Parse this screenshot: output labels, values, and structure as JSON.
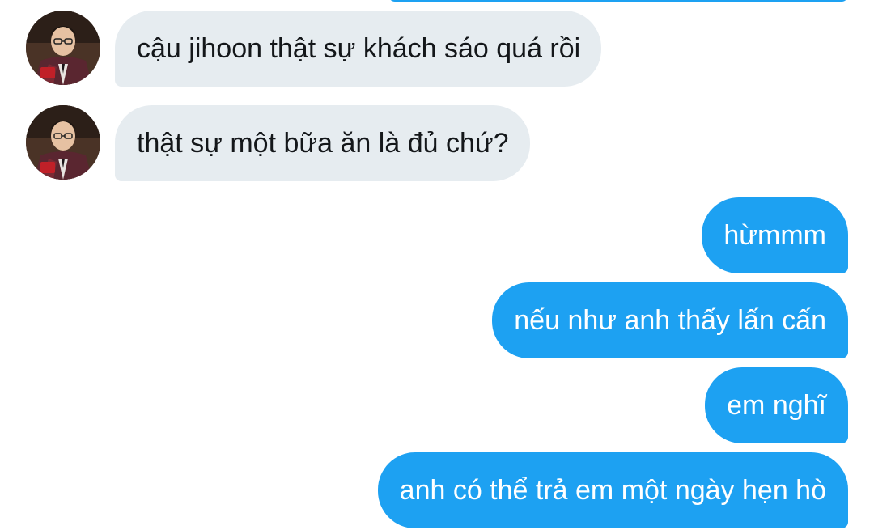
{
  "conversation": {
    "incoming": [
      {
        "text": "cậu jihoon thật sự khách sáo quá rồi"
      },
      {
        "text": "thật sự một bữa ăn là đủ chứ?"
      }
    ],
    "outgoing": [
      {
        "text": "hừmmm"
      },
      {
        "text": "nếu như anh thấy lấn cấn"
      },
      {
        "text": "em nghĩ"
      },
      {
        "text": "anh có thể trả em một ngày hẹn hò"
      }
    ]
  },
  "colors": {
    "outgoing_bubble": "#1da1f2",
    "incoming_bubble": "#e6ecf0",
    "incoming_text": "#14171a",
    "outgoing_text": "#ffffff"
  },
  "icons": {
    "avatar": "profile-photo"
  }
}
